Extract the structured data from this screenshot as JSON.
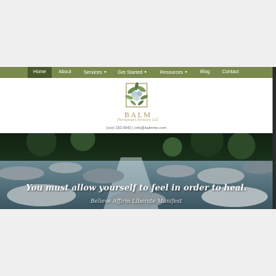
{
  "nav": {
    "items": [
      {
        "label": "Home",
        "active": true,
        "dropdown": false
      },
      {
        "label": "About",
        "active": false,
        "dropdown": false
      },
      {
        "label": "Services",
        "active": false,
        "dropdown": true
      },
      {
        "label": "Get Started",
        "active": false,
        "dropdown": true
      },
      {
        "label": "Resources",
        "active": false,
        "dropdown": true
      },
      {
        "label": "Blog",
        "active": false,
        "dropdown": false
      },
      {
        "label": "Contact",
        "active": false,
        "dropdown": false
      }
    ],
    "dropdown_icon": "caret-down-icon"
  },
  "logo": {
    "name": "BALM",
    "tagline": "Therapeutic Services, LLC",
    "icon": "leaf-frame-icon"
  },
  "contact": {
    "phone": "(xxx) 282-8942",
    "separator": "|",
    "email": "info@balmme.com"
  },
  "hero": {
    "headline": "You must allow yourself to feel in order to heal.",
    "subline": "Believe Affirm Liberate Manifest"
  },
  "colors": {
    "nav_bg": "#7a8a4e",
    "nav_active": "#4a5a2e",
    "brand_gold": "#a69563",
    "page_bg": "#f0f0f0"
  }
}
